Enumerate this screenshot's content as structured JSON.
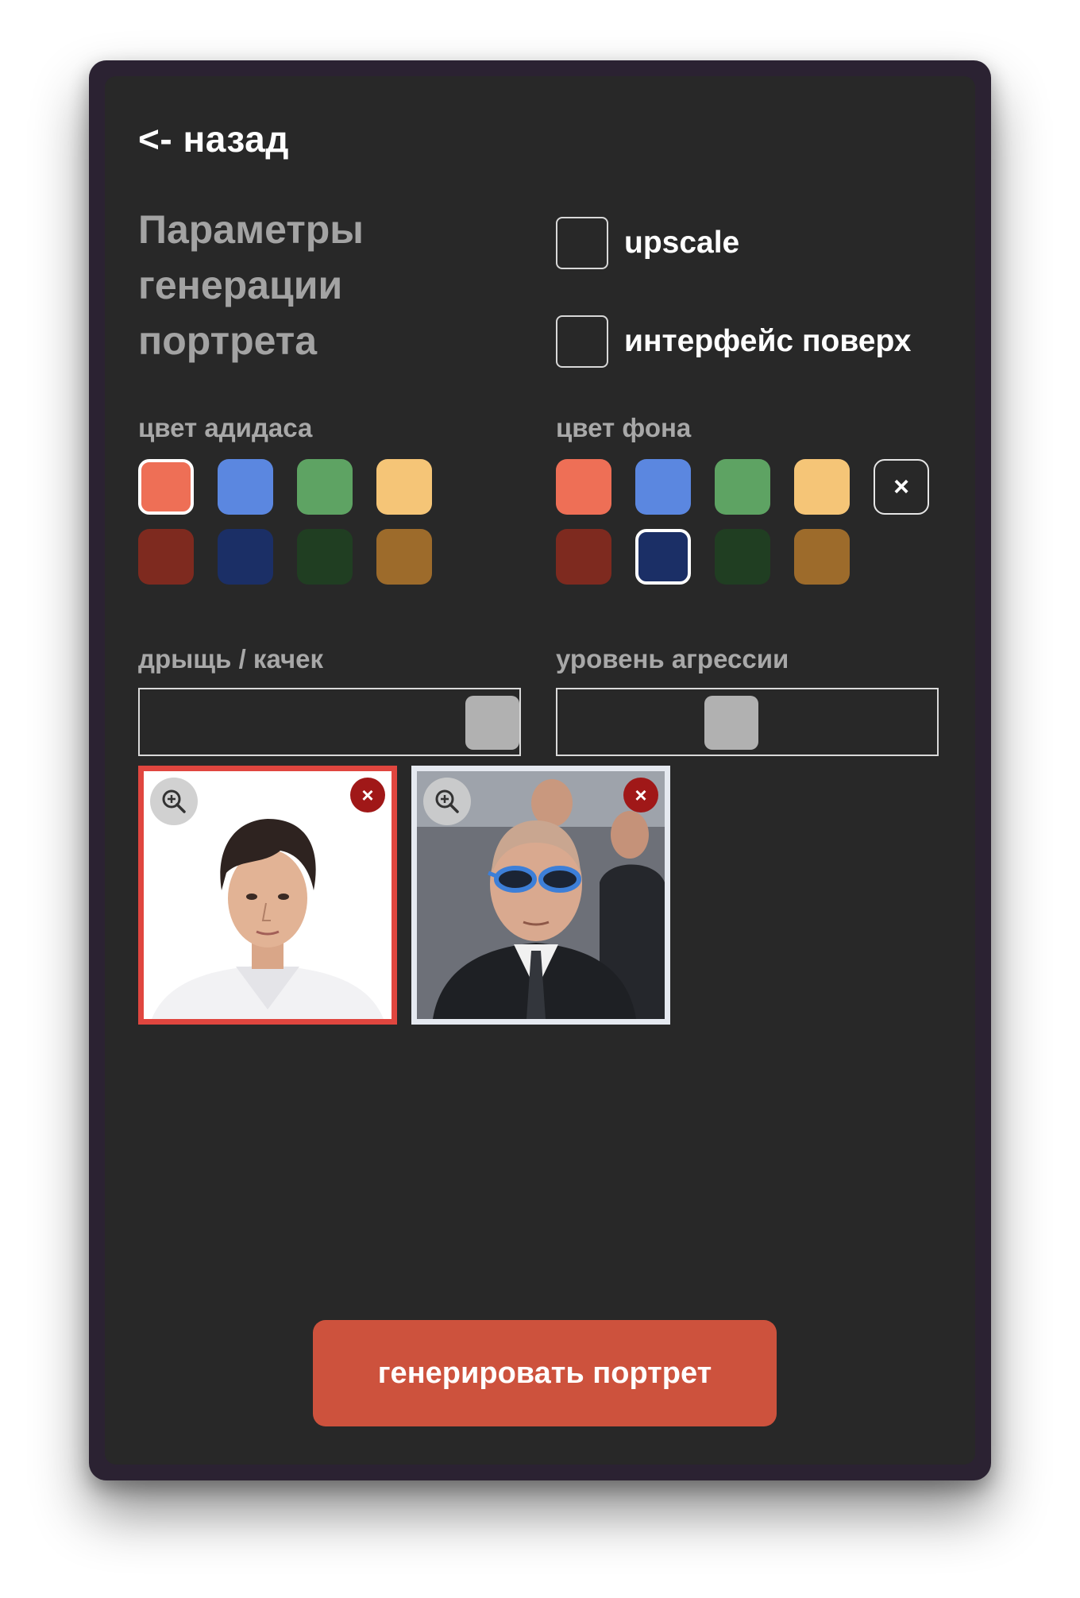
{
  "back": {
    "label": "<- назад"
  },
  "title": {
    "line1": "Параметры",
    "line2": "генерации",
    "line3": "портрета"
  },
  "options": {
    "upscale": {
      "label": "upscale",
      "checked": false
    },
    "overlay": {
      "label": "интерфейс поверх",
      "checked": false
    }
  },
  "adidas_color": {
    "label": "цвет адидаса",
    "swatches": [
      "#ee6f56",
      "#5b87e0",
      "#5ea363",
      "#f5c577",
      "#7e2a1f",
      "#1b2f66",
      "#203e22",
      "#9d6b2b"
    ],
    "selected": "#ee6f56"
  },
  "background_color": {
    "label": "цвет фона",
    "swatches": [
      "#ee6f56",
      "#5b87e0",
      "#5ea363",
      "#f5c577",
      "#7e2a1f",
      "#1b2f66",
      "#203e22",
      "#9d6b2b"
    ],
    "selected": "#1b2f66",
    "clear_symbol": "×"
  },
  "build_slider": {
    "label": "дрыщь / качек",
    "value_fraction": 1.0
  },
  "aggression_slider": {
    "label": "уровень агрессии",
    "value_fraction": 0.45
  },
  "photos": [
    {
      "name": "photo-young-man",
      "selected": true,
      "zoom_icon": "zoom-in-icon",
      "remove_symbol": "×"
    },
    {
      "name": "photo-man-sunglasses",
      "selected": false,
      "zoom_icon": "zoom-in-icon",
      "remove_symbol": "×"
    }
  ],
  "generate": {
    "label": "генерировать портрет"
  }
}
